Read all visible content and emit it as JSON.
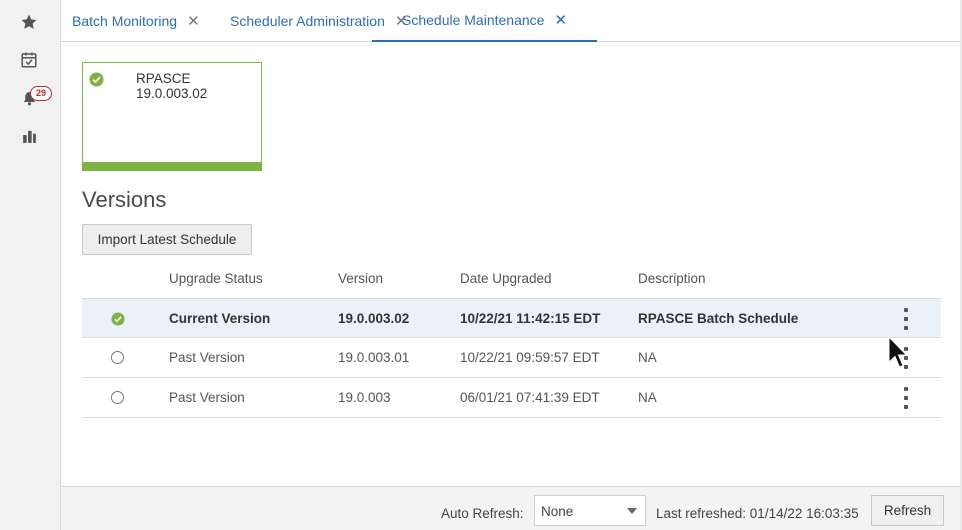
{
  "sidebar": {
    "items": [
      {
        "icon": "star-icon"
      },
      {
        "icon": "calendar-check-icon"
      },
      {
        "icon": "bell-icon",
        "badge": "29"
      },
      {
        "icon": "bar-chart-icon"
      }
    ]
  },
  "tabs": [
    {
      "label": "Batch Monitoring",
      "active": false
    },
    {
      "label": "Scheduler Administration",
      "active": false
    },
    {
      "label": "Schedule Maintenance",
      "active": true
    }
  ],
  "card": {
    "title": "RPASCE 19.0.003.02",
    "status": "success"
  },
  "versions": {
    "heading": "Versions",
    "import_button": "Import Latest Schedule",
    "columns": [
      "Upgrade Status",
      "Version",
      "Date Upgraded",
      "Description"
    ],
    "rows": [
      {
        "status": "Current Version",
        "version": "19.0.003.02",
        "date": "10/22/21 11:42:15 EDT",
        "description": "RPASCE Batch Schedule",
        "current": true
      },
      {
        "status": "Past Version",
        "version": "19.0.003.01",
        "date": "10/22/21 09:59:57 EDT",
        "description": "NA",
        "current": false
      },
      {
        "status": "Past Version",
        "version": "19.0.003",
        "date": "06/01/21 07:41:39 EDT",
        "description": "NA",
        "current": false
      }
    ]
  },
  "footer": {
    "auto_refresh_label": "Auto Refresh:",
    "auto_refresh_value": "None",
    "last_refreshed": "Last refreshed: 01/14/22 16:03:35",
    "refresh_button": "Refresh"
  },
  "colors": {
    "accent": "#2f6bb4",
    "success": "#7cb342",
    "badge": "#c0252b",
    "row_highlight": "#eaf1f9"
  }
}
